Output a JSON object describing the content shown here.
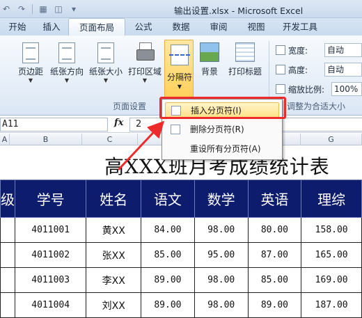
{
  "window": {
    "title": "输出设置.xlsx - Microsoft Excel"
  },
  "ribbon_tabs": [
    {
      "label": "开始",
      "active": false
    },
    {
      "label": "插入",
      "active": false
    },
    {
      "label": "页面布局",
      "active": true
    },
    {
      "label": "公式",
      "active": false
    },
    {
      "label": "数据",
      "active": false
    },
    {
      "label": "审阅",
      "active": false
    },
    {
      "label": "视图",
      "active": false
    },
    {
      "label": "开发工具",
      "active": false
    }
  ],
  "ribbon": {
    "margins": "页边距",
    "orientation": "纸张方向",
    "size": "纸张大小",
    "print_area": "打印区域",
    "breaks": "分隔符",
    "background": "背景",
    "print_titles": "打印标题",
    "group_page_setup": "页面设置",
    "width_label": "宽度:",
    "width_value": "自动",
    "height_label": "高度:",
    "height_value": "自动",
    "scale_label": "缩放比例:",
    "scale_value": "100%",
    "group_scale": "调整为合适大小"
  },
  "formula_bar": {
    "name_box": "A11",
    "fx": "fx",
    "value": "2"
  },
  "columns": [
    "A",
    "B",
    "C",
    "D",
    "E",
    "F",
    "G"
  ],
  "menu": {
    "items": [
      {
        "label": "插入分页符(I)",
        "highlighted": true
      },
      {
        "label": "删除分页符(R)",
        "highlighted": false
      },
      {
        "label": "重设所有分页符(A)",
        "highlighted": false
      }
    ]
  },
  "sheet": {
    "title": "高XXX班月考成绩统计表",
    "headers": [
      "级",
      "学号",
      "姓名",
      "语文",
      "数学",
      "英语",
      "理综"
    ],
    "rows": [
      [
        "",
        "4011001",
        "黄XX",
        "84.00",
        "98.00",
        "80.00",
        "158.00"
      ],
      [
        "",
        "4011002",
        "张XX",
        "85.00",
        "95.00",
        "87.00",
        "165.00"
      ],
      [
        "",
        "4011003",
        "李XX",
        "89.00",
        "98.00",
        "85.00",
        "169.00"
      ],
      [
        "",
        "4011004",
        "刘XX",
        "89.00",
        "98.00",
        "89.00",
        "187.00"
      ]
    ]
  },
  "colors": {
    "header_fill": "#0e1c6e",
    "highlight_box": "#ee2a2a"
  }
}
